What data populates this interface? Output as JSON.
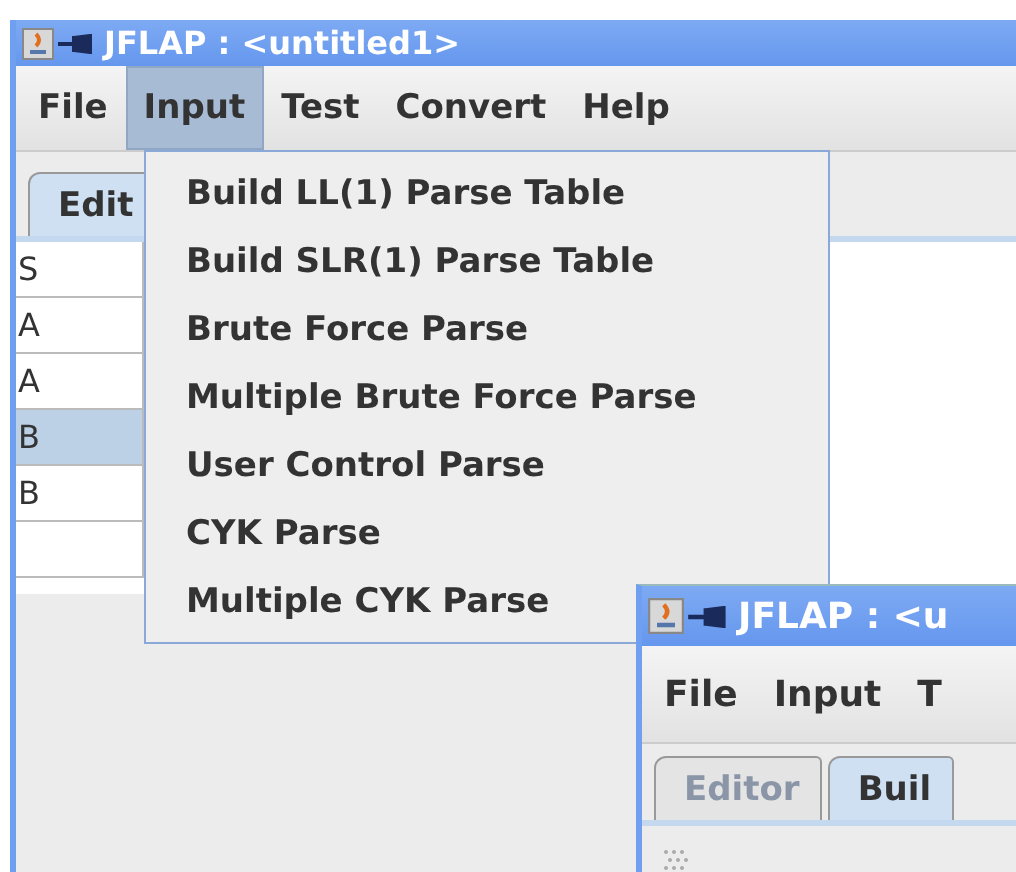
{
  "main_window": {
    "title": "JFLAP : <untitled1>",
    "menus": [
      {
        "label": "File",
        "selected": false
      },
      {
        "label": "Input",
        "selected": true
      },
      {
        "label": "Test",
        "selected": false
      },
      {
        "label": "Convert",
        "selected": false
      },
      {
        "label": "Help",
        "selected": false
      }
    ],
    "tabs": [
      {
        "label": "Edit",
        "selected": true
      }
    ],
    "table": {
      "rows": [
        {
          "column_1": "S",
          "selected": false
        },
        {
          "column_1": "A",
          "selected": false
        },
        {
          "column_1": "A",
          "selected": false
        },
        {
          "column_1": "B",
          "selected": true
        },
        {
          "column_1": "B",
          "selected": false
        }
      ]
    }
  },
  "input_menu": {
    "items": [
      "Build LL(1) Parse Table",
      "Build SLR(1) Parse Table",
      "Brute Force Parse",
      "Multiple Brute Force Parse",
      "User Control Parse",
      "CYK Parse",
      "Multiple CYK Parse"
    ]
  },
  "second_window": {
    "title": "JFLAP : <u",
    "menus": [
      {
        "label": "File",
        "selected": false
      },
      {
        "label": "Input",
        "selected": false
      },
      {
        "label": "T",
        "selected": false
      }
    ],
    "tabs": [
      {
        "label": "Editor",
        "selected": false
      },
      {
        "label": "Buil",
        "selected": true
      }
    ]
  }
}
